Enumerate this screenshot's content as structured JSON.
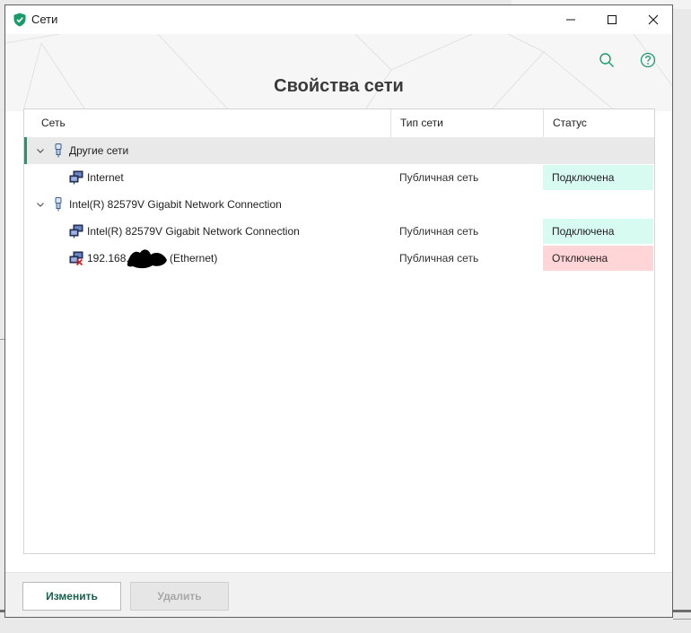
{
  "window": {
    "title": "Сети",
    "accent": "#1a9b6c"
  },
  "header": {
    "page_title": "Свойства сети",
    "search_icon": "search-icon",
    "help_icon": "help-icon"
  },
  "table": {
    "columns": [
      "Сеть",
      "Тип сети",
      "Статус"
    ],
    "groups": [
      {
        "name": "Другие сети",
        "expanded": true,
        "selected": true,
        "items": [
          {
            "name": "Internet",
            "type": "Публичная сеть",
            "status": "Подключена",
            "connected": true
          }
        ]
      },
      {
        "name": "Intel(R) 82579V Gigabit Network Connection",
        "expanded": true,
        "selected": false,
        "items": [
          {
            "name": "Intel(R) 82579V Gigabit Network Connection",
            "type": "Публичная сеть",
            "status": "Подключена",
            "connected": true
          },
          {
            "name_prefix": "192.168.",
            "name_suffix": "(Ethernet)",
            "type": "Публичная сеть",
            "status": "Отключена",
            "connected": false
          }
        ]
      }
    ]
  },
  "status_colors": {
    "connected_bg": "#d7fbf1",
    "disconnected_bg": "#ffd5d8"
  },
  "footer": {
    "edit_label": "Изменить",
    "delete_label": "Удалить"
  }
}
